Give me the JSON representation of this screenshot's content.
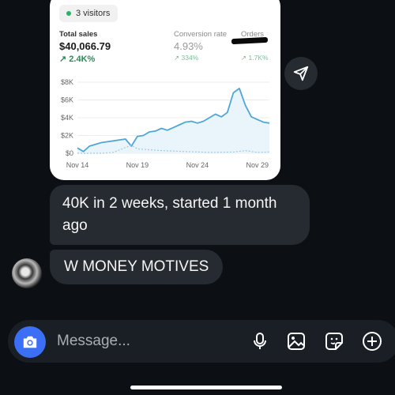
{
  "card": {
    "visitors": "3 visitors",
    "total_sales": {
      "label": "Total sales",
      "value": "$40,066.79",
      "change": "2.4K%"
    },
    "conversion": {
      "label": "Conversion rate",
      "value": "4.93%",
      "change": "334%"
    },
    "orders": {
      "label": "Orders",
      "change": "1.7K%"
    }
  },
  "chart_data": {
    "type": "line",
    "x_tick_labels": [
      "Nov 14",
      "Nov 19",
      "Nov 24",
      "Nov 29"
    ],
    "y_tick_labels": [
      "$8K",
      "$6K",
      "$4K",
      "$2K",
      "$0"
    ],
    "ylim": [
      0,
      8000
    ],
    "series": [
      {
        "style": "solid",
        "x": [
          0,
          0.5,
          1,
          1.5,
          2,
          2.5,
          3,
          3.5,
          4,
          4.5,
          5,
          5.5,
          6,
          6.5,
          7,
          7.5,
          8,
          8.5,
          9,
          9.5,
          10,
          10.5,
          11,
          11.5,
          12,
          12.5,
          13,
          13.5,
          14,
          14.5,
          15,
          15.5,
          16
        ],
        "values": [
          600,
          200,
          800,
          1000,
          1200,
          1300,
          1400,
          1500,
          1600,
          800,
          1900,
          2000,
          2400,
          2500,
          2800,
          2600,
          2900,
          3200,
          3500,
          3600,
          3400,
          3600,
          4000,
          4400,
          4100,
          4600,
          6800,
          7300,
          5400,
          4100,
          3800,
          3500,
          3400
        ]
      },
      {
        "style": "dashed",
        "x": [
          0,
          1,
          2,
          3,
          4,
          4.5,
          5,
          6,
          7,
          8,
          9,
          10,
          11,
          12,
          13,
          14,
          15,
          16
        ],
        "values": [
          0,
          0,
          0,
          100,
          650,
          900,
          500,
          400,
          300,
          250,
          200,
          150,
          100,
          120,
          130,
          300,
          100,
          150
        ]
      }
    ]
  },
  "messages": [
    {
      "text": "40K in 2 weeks, started 1 month ago"
    },
    {
      "text": "W MONEY MOTIVES"
    }
  ],
  "composer": {
    "placeholder": "Message..."
  },
  "colors": {
    "bubble": "#262b31",
    "accent": "#3b6ff5",
    "line": "#4fa7d8",
    "positive": "#2e8a57"
  },
  "icons": [
    "send-icon",
    "camera-icon",
    "microphone-icon",
    "gallery-icon",
    "sticker-icon",
    "plus-icon"
  ]
}
